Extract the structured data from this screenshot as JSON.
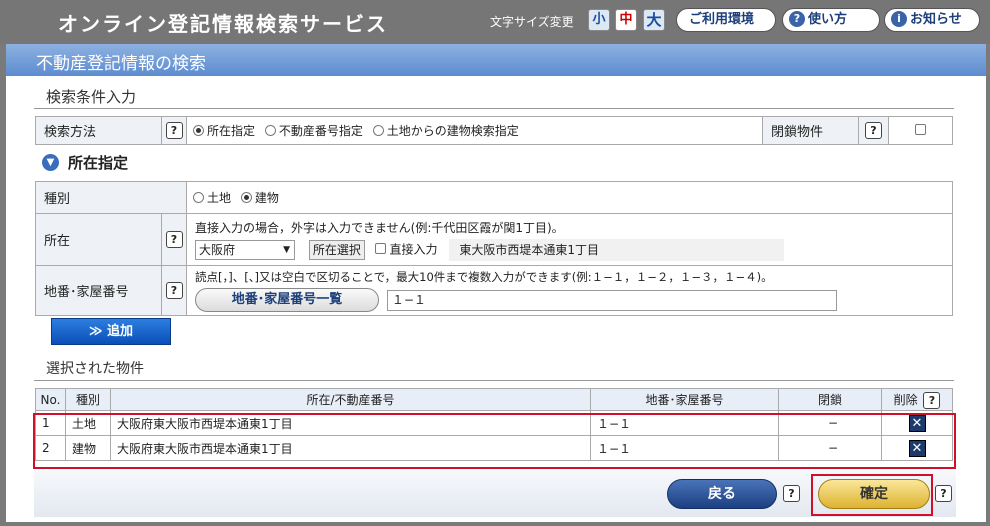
{
  "topbar": {
    "title": "オンライン登記情報検索サービス",
    "font_size_label": "文字サイズ変更",
    "font_small": "小",
    "font_medium": "中",
    "font_large": "大",
    "env_label": "ご利用環境",
    "howto_label": "使い方",
    "news_label": "お知らせ"
  },
  "page_title": "不動産登記情報の検索",
  "search": {
    "section_title": "検索条件入力",
    "method_label": "検索方法",
    "methods": [
      "所在指定",
      "不動産番号指定",
      "土地からの建物検索指定"
    ],
    "selected_method": 0,
    "closed_label": "閉鎖物件"
  },
  "location": {
    "title": "所在指定",
    "type_label": "種別",
    "type_options": [
      "土地",
      "建物"
    ],
    "selected_type": 1,
    "address_label": "所在",
    "address_note": "直接入力の場合，外字は入力できません(例:千代田区霞が関1丁目)。",
    "prefecture": "大阪府",
    "address_select_btn": "所在選択",
    "direct_input_label": "直接入力",
    "address_value": "東大阪市西堤本通東1丁目",
    "lot_label": "地番･家屋番号",
    "lot_note": "読点[，]、[、]又は空白で区切ることで，最大10件まで複数入力ができます(例:１−１，１−２，１−３，１−４)。",
    "lot_list_btn": "地番･家屋番号一覧",
    "lot_value": "１−１"
  },
  "add_button": "≫ 追加",
  "selected": {
    "section_title": "選択された物件",
    "headers": [
      "No.",
      "種別",
      "所在/不動産番号",
      "地番･家屋番号",
      "閉鎖",
      "削除"
    ],
    "rows": [
      {
        "no": "1",
        "type": "土地",
        "address": "大阪府東大阪市西堤本通東1丁目",
        "lot": "１−１",
        "closed": "−"
      },
      {
        "no": "2",
        "type": "建物",
        "address": "大阪府東大阪市西堤本通東1丁目",
        "lot": "１−１",
        "closed": "−"
      }
    ]
  },
  "footer": {
    "back_label": "戻る",
    "confirm_label": "確定"
  },
  "help_glyph": "?",
  "delete_glyph": "✕",
  "info_glyph": "i"
}
